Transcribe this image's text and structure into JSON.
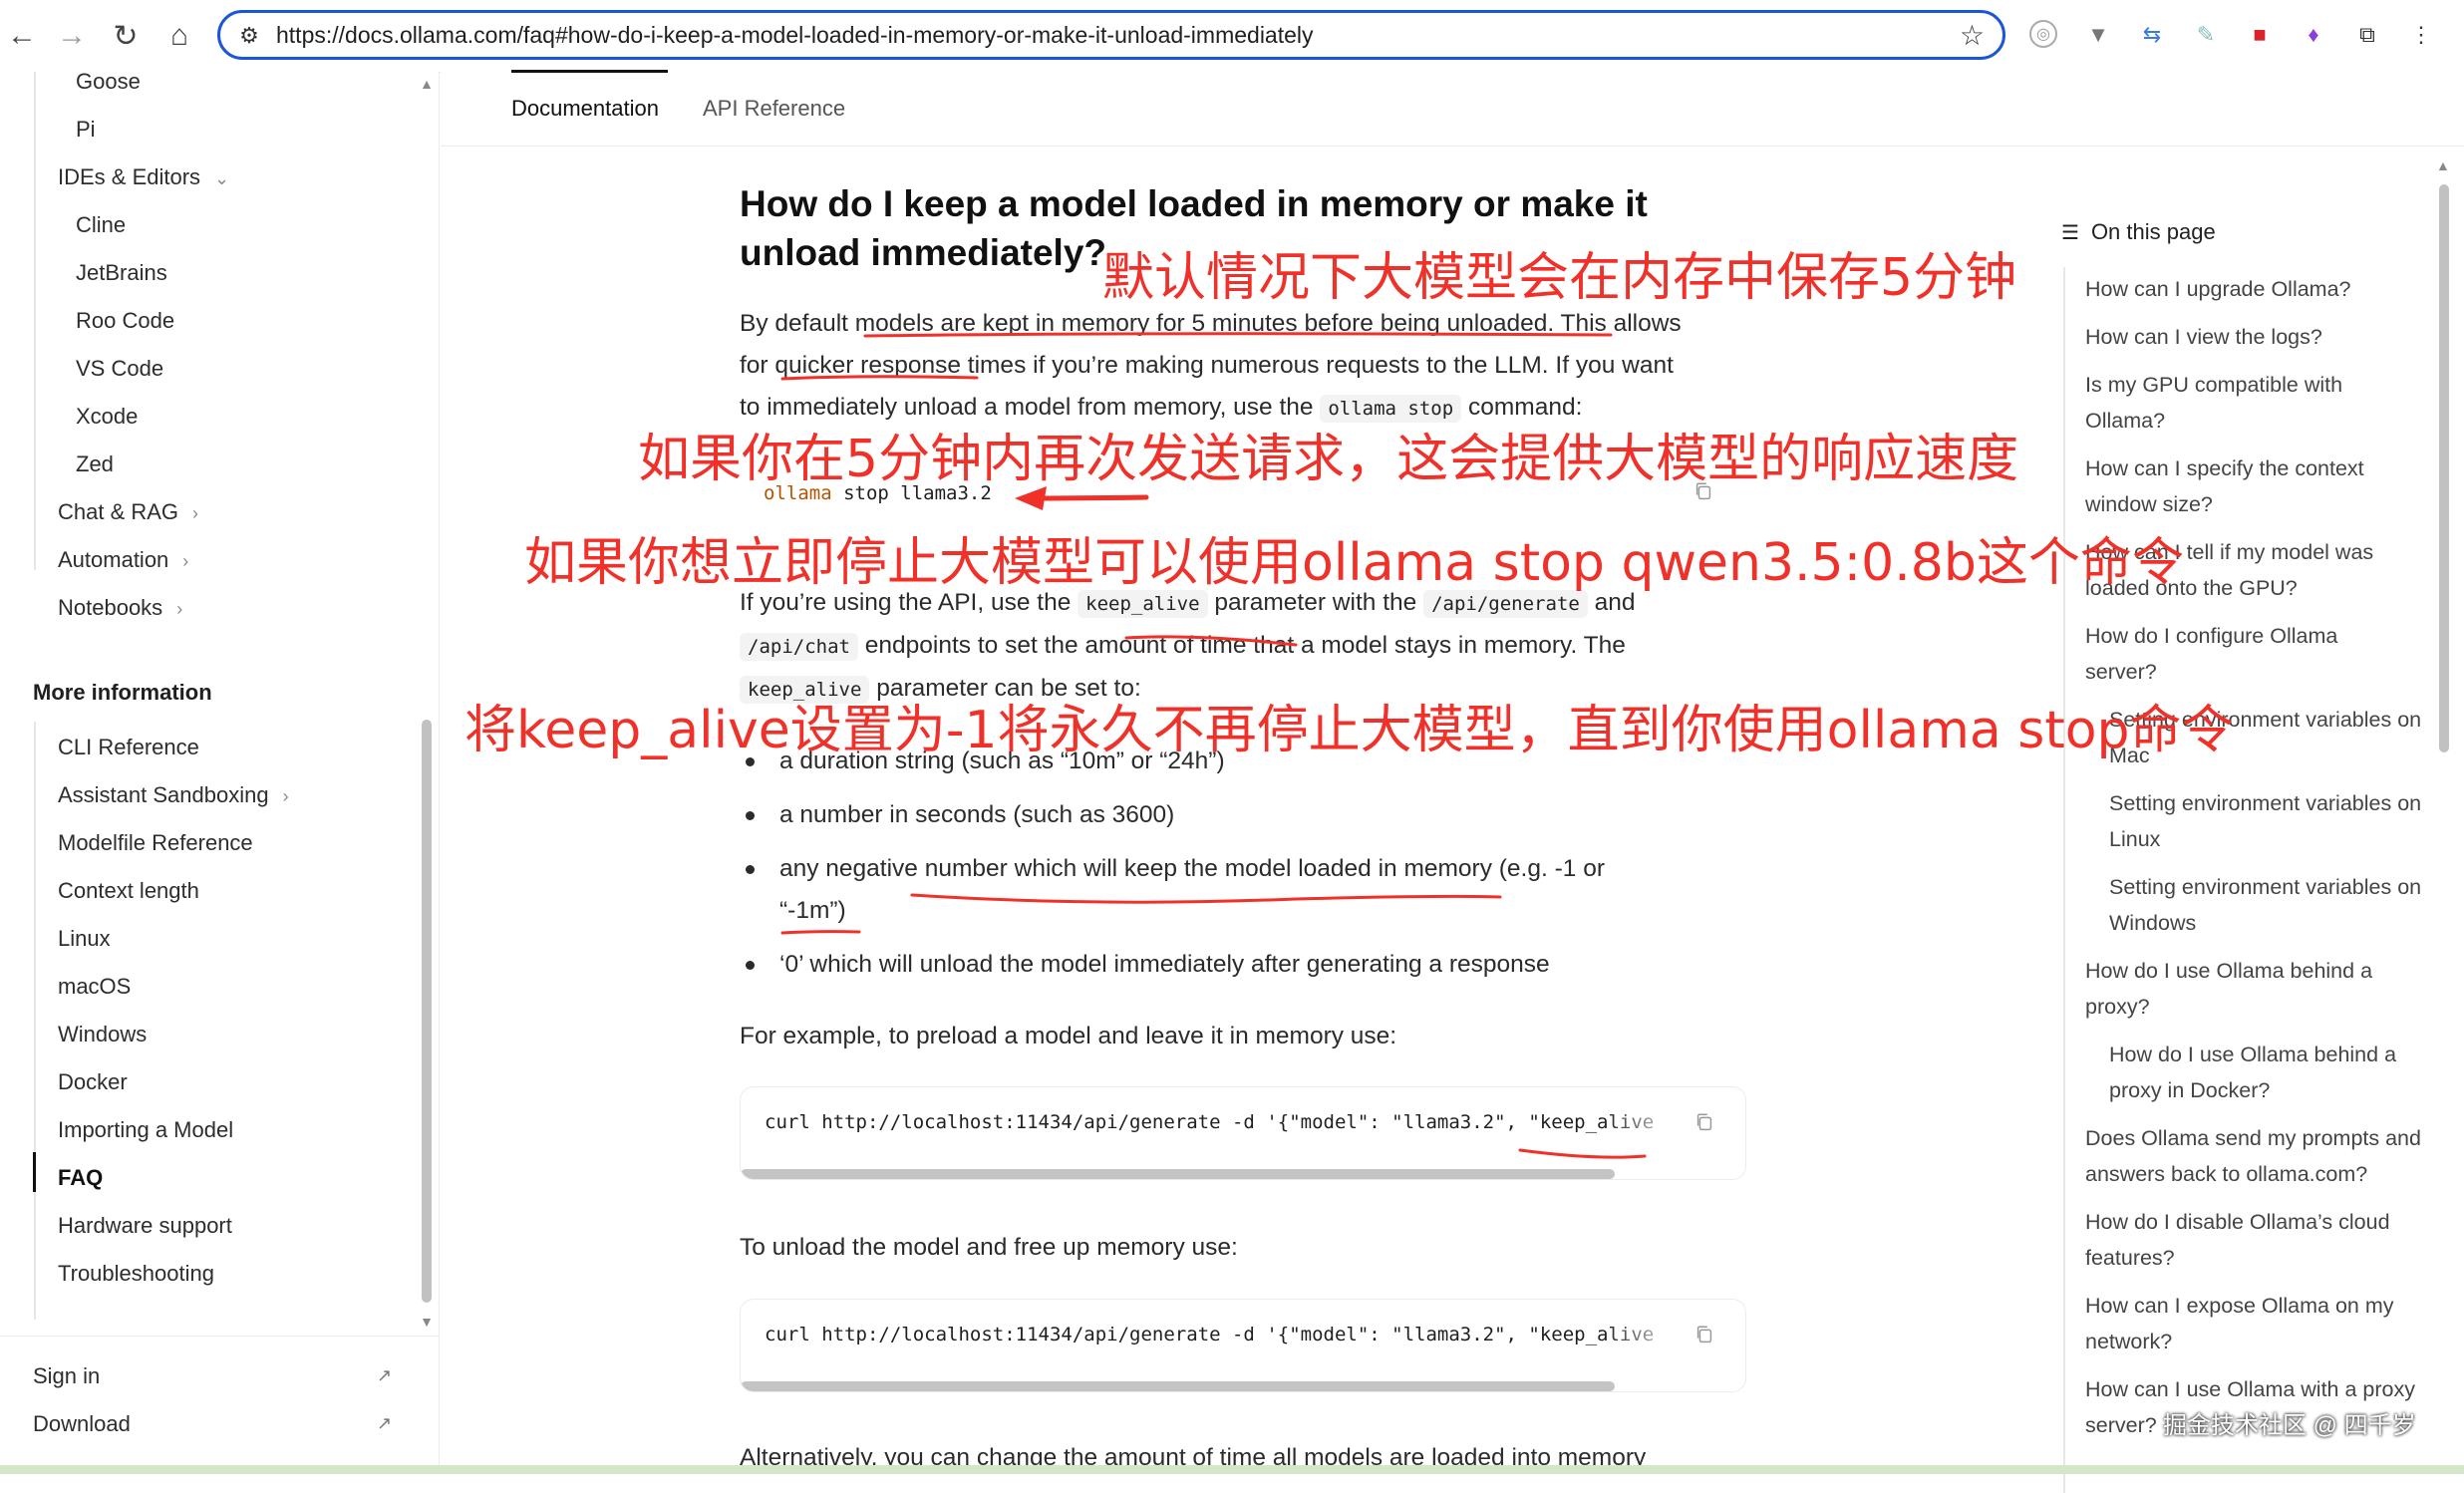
{
  "browser": {
    "url": "https://docs.ollama.com/faq#how-do-i-keep-a-model-loaded-in-memory-or-make-it-unload-immediately",
    "back_icon": "arrow-left-icon",
    "forward_icon": "arrow-right-icon",
    "reload_icon": "reload-icon",
    "home_icon": "home-icon",
    "bookmark_icon": "star-icon"
  },
  "sidebar": {
    "items_top": [
      {
        "label": "Goose"
      },
      {
        "label": "Pi"
      }
    ],
    "ides_group": {
      "label": "IDEs & Editors",
      "chevron": "⌄"
    },
    "ide_items": [
      {
        "label": "Cline"
      },
      {
        "label": "JetBrains"
      },
      {
        "label": "Roo Code"
      },
      {
        "label": "VS Code"
      },
      {
        "label": "Xcode"
      },
      {
        "label": "Zed"
      }
    ],
    "groups": [
      {
        "label": "Chat & RAG",
        "chevron": "›"
      },
      {
        "label": "Automation",
        "chevron": "›"
      },
      {
        "label": "Notebooks",
        "chevron": "›"
      }
    ],
    "more_info_heading": "More information",
    "more_info_items": [
      {
        "label": "CLI Reference"
      },
      {
        "label": "Assistant Sandboxing",
        "chevron": "›"
      },
      {
        "label": "Modelfile Reference"
      },
      {
        "label": "Context length"
      },
      {
        "label": "Linux"
      },
      {
        "label": "macOS"
      },
      {
        "label": "Windows"
      },
      {
        "label": "Docker"
      },
      {
        "label": "Importing a Model"
      },
      {
        "label": "FAQ",
        "active": true
      },
      {
        "label": "Hardware support"
      },
      {
        "label": "Troubleshooting"
      }
    ],
    "footer": [
      {
        "label": "Sign in",
        "icon": "↗"
      },
      {
        "label": "Download",
        "icon": "↗"
      }
    ]
  },
  "tabs": [
    {
      "label": "Documentation",
      "active": true
    },
    {
      "label": "API Reference"
    }
  ],
  "content": {
    "title_line1": "How do I keep a model loaded in memory or make it",
    "title_line2": "unload immediately?",
    "p1_line1_a": "By default models are kept in memory for 5 minutes before being unloaded. This allows",
    "p1_line2": "for quicker response times if you’re making numerous requests to the LLM. If you want",
    "p1_line3_a": "to immediately unload a model from memory, use the",
    "p1_line3_code": "ollama stop",
    "p1_line3_b": "command:",
    "code1": "ollama stop llama3.2",
    "p2_line1_a": "If you’re using the API, use the",
    "p2_line1_code1": "keep_alive",
    "p2_line1_b": "parameter with the",
    "p2_line1_code2": "/api/generate",
    "p2_line1_c": "and",
    "p2_line2_code": "/api/chat",
    "p2_line2_b": "endpoints to set the amount of time that a model stays in memory. The",
    "p2_line3_code": "keep_alive",
    "p2_line3_b": "parameter can be set to:",
    "bullets": [
      "a duration string (such as “10m” or “24h”)",
      "a number in seconds (such as 3600)",
      "any negative number which will keep the model loaded in memory (e.g. -1 or",
      "“-1m”)",
      "‘0’ which will unload the model immediately after generating a response"
    ],
    "p3": "For example, to preload a model and leave it in memory use:",
    "code2": "curl http://localhost:11434/api/generate -d '{\"model\": \"llama3.2\", \"keep_alive",
    "p4": "To unload the model and free up memory use:",
    "code3": "curl http://localhost:11434/api/generate -d '{\"model\": \"llama3.2\", \"keep_alive",
    "p5": "Alternatively, you can change the amount of time all models are loaded into memory"
  },
  "toc": {
    "heading": "On this page",
    "items": [
      {
        "label": "How can I upgrade Ollama?"
      },
      {
        "label": "How can I view the logs?"
      },
      {
        "label": "Is my GPU compatible with Ollama?"
      },
      {
        "label": "How can I specify the context window size?"
      },
      {
        "label": "How can I tell if my model was loaded onto the GPU?"
      },
      {
        "label": "How do I configure Ollama server?"
      },
      {
        "label": "Setting environment variables on Mac",
        "sub": true
      },
      {
        "label": "Setting environment variables on Linux",
        "sub": true
      },
      {
        "label": "Setting environment variables on Windows",
        "sub": true
      },
      {
        "label": "How do I use Ollama behind a proxy?"
      },
      {
        "label": "How do I use Ollama behind a proxy in Docker?",
        "sub": true
      },
      {
        "label": "Does Ollama send my prompts and answers back to ollama.com?"
      },
      {
        "label": "How do I disable Ollama’s cloud features?"
      },
      {
        "label": "How can I expose Ollama on my network?"
      },
      {
        "label": "How can I use Ollama with a proxy server?"
      }
    ]
  },
  "annotations": {
    "a1": "默认情况下大模型会在内存中保存5分钟",
    "a2": "如果你在5分钟内再次发送请求，这会提供大模型的响应速度",
    "a3": "如果你想立即停止大模型可以使用ollama stop qwen3.5:0.8b这个命令",
    "a4": "将keep_alive设置为-1将永久不再停止大模型，直到你使用ollama stop命令",
    "color": "#f0312a"
  },
  "watermark": "掘金技术社区 @ 四千岁"
}
